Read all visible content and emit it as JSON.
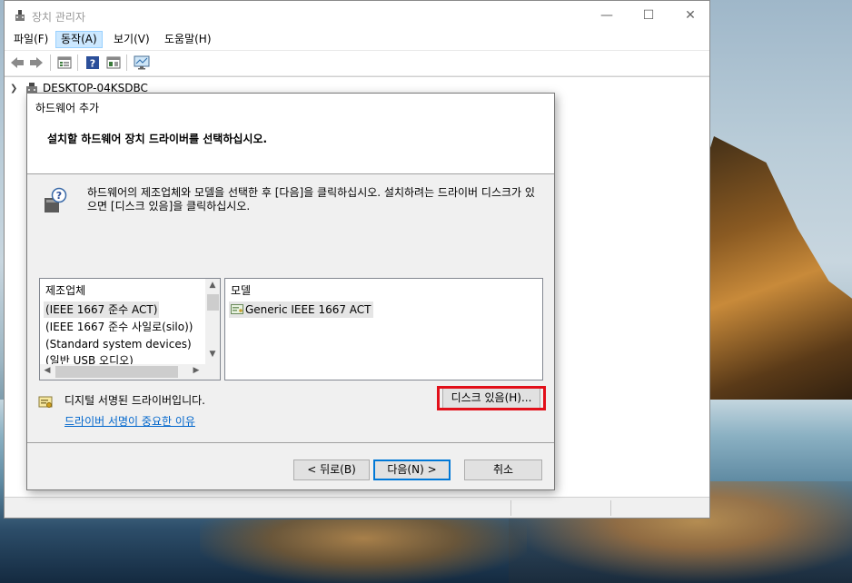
{
  "window": {
    "title": "장치 관리자",
    "minimize": "—",
    "maximize": "☐",
    "close": "✕"
  },
  "menu": [
    {
      "label": "파일(F)",
      "active": false
    },
    {
      "label": "동작(A)",
      "active": true
    },
    {
      "label": "보기(V)",
      "active": false
    },
    {
      "label": "도움말(H)",
      "active": false
    }
  ],
  "tree": {
    "root": "DESKTOP-04KSDBC"
  },
  "dialog": {
    "title": "하드웨어 추가",
    "heading": "설치할 하드웨어 장치 드라이버를 선택하십시오.",
    "info": "하드웨어의 제조업체와 모델을 선택한 후 [다음]을 클릭하십시오. 설치하려는 드라이버 디스크가 있으면 [디스크 있음]을 클릭하십시오.",
    "manufacturer_header": "제조업체",
    "manufacturers": [
      "(IEEE 1667 준수 ACT)",
      "(IEEE 1667 준수 사일로(silo))",
      "(Standard system devices)",
      "(일반 USB 오디오)"
    ],
    "model_header": "모델",
    "models": [
      "Generic IEEE 1667 ACT"
    ],
    "signed_text": "디지털 서명된 드라이버입니다.",
    "signed_link": "드라이버 서명이 중요한 이유",
    "have_disk": "디스크 있음(H)...",
    "back": "< 뒤로(B)",
    "next": "다음(N) >",
    "cancel": "취소",
    "highlight_color": "#e2101a"
  }
}
